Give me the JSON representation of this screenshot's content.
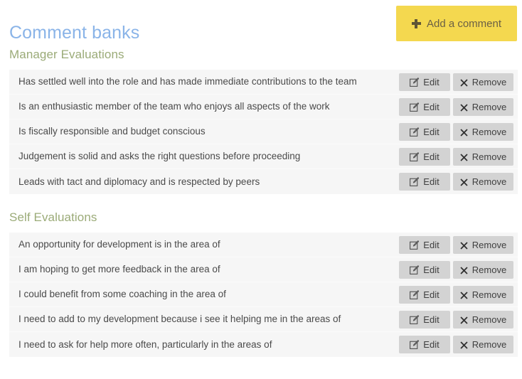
{
  "header": {
    "title": "Comment banks",
    "add_button": {
      "label": "Add a comment",
      "icon": "plus-icon"
    }
  },
  "theme": {
    "title_color": "#8ab4e8",
    "section_heading_color": "#9bab78",
    "accent_button_bg": "#f4d84f",
    "accent_button_text": "#6b6045",
    "row_bg": "#f6f6f6",
    "row_border": "#fbfbfb",
    "action_button_bg": "#d3d3d3",
    "action_button_text": "#404040",
    "comment_text_color": "#4a4a4a"
  },
  "actions": {
    "edit_label": "Edit",
    "edit_icon": "pencil-square-icon",
    "remove_label": "Remove",
    "remove_icon": "close-x-icon"
  },
  "sections": [
    {
      "heading": "Manager Evaluations",
      "comments": [
        "Has settled well into the role and has made immediate contributions to the team",
        "Is an enthusiastic member of the team who enjoys all aspects of the work",
        "Is fiscally responsible and budget conscious",
        "Judgement is solid and asks the right questions before proceeding",
        "Leads with tact and diplomacy and is respected by peers"
      ]
    },
    {
      "heading": "Self Evaluations",
      "comments": [
        "An opportunity for development is in the area of",
        "I am hoping to get more feedback in the area of",
        "I could benefit from some coaching in the area of",
        "I need to add to my development because i see it helping me in the areas of",
        "I need to ask for help more often, particularly in the areas of"
      ]
    }
  ]
}
